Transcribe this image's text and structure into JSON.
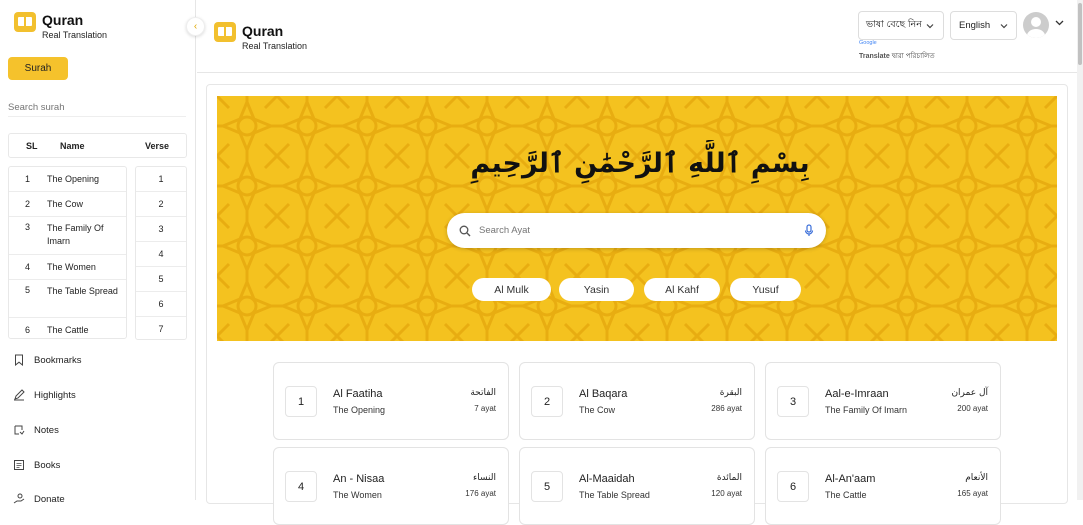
{
  "app": {
    "title": "Quran",
    "subtitle": "Real Translation"
  },
  "colors": {
    "accent": "#f5c22c",
    "hero_bg": "#f4c21f",
    "hero_pattern": "#e7a70f"
  },
  "sidebar": {
    "surah_button": "Surah",
    "search_placeholder": "Search surah",
    "table_headers": {
      "sl": "SL",
      "name": "Name",
      "verse": "Verse"
    },
    "rows": [
      {
        "sl": "1",
        "name": "The Opening"
      },
      {
        "sl": "2",
        "name": "The Cow"
      },
      {
        "sl": "3",
        "name": "The Family Of Imarn"
      },
      {
        "sl": "4",
        "name": "The Women"
      },
      {
        "sl": "5",
        "name": "The Table Spread"
      },
      {
        "sl": "6",
        "name": "The Cattle"
      }
    ],
    "verses": [
      "1",
      "2",
      "3",
      "4",
      "5",
      "6",
      "7"
    ],
    "menu": [
      {
        "label": "Bookmarks",
        "icon": "bookmark-icon"
      },
      {
        "label": "Highlights",
        "icon": "highlight-pen-icon"
      },
      {
        "label": "Notes",
        "icon": "notes-icon"
      },
      {
        "label": "Books",
        "icon": "book-icon"
      },
      {
        "label": "Donate",
        "icon": "donate-icon"
      }
    ]
  },
  "header": {
    "lang_select": "ভাষা বেছে নিন",
    "google": "Google",
    "translate": "Translate",
    "translate_suffix": " দ্বারা পরিচালিত",
    "language": "English"
  },
  "hero": {
    "bismillah": "بِسْمِ ٱللَّهِ ٱلرَّحْمَٰنِ ٱلرَّحِيمِ",
    "search_placeholder": "Search Ayat",
    "chips": [
      "Al Mulk",
      "Yasin",
      "Al Kahf",
      "Yusuf"
    ]
  },
  "cards": [
    {
      "num": "1",
      "name": "Al Faatiha",
      "meaning": "The Opening",
      "arabic": "الفاتحة",
      "ayat": "7 ayat"
    },
    {
      "num": "2",
      "name": "Al Baqara",
      "meaning": "The Cow",
      "arabic": "البقرة",
      "ayat": "286 ayat"
    },
    {
      "num": "3",
      "name": "Aal-e-Imraan",
      "meaning": "The Family Of Imarn",
      "arabic": "آل عمران",
      "ayat": "200 ayat"
    },
    {
      "num": "4",
      "name": "An - Nisaa",
      "meaning": "The Women",
      "arabic": "النساء",
      "ayat": "176 ayat"
    },
    {
      "num": "5",
      "name": "Al-Maaidah",
      "meaning": "The Table Spread",
      "arabic": "المائدة",
      "ayat": "120 ayat"
    },
    {
      "num": "6",
      "name": "Al-An'aam",
      "meaning": "The Cattle",
      "arabic": "الأنعام",
      "ayat": "165 ayat"
    }
  ]
}
